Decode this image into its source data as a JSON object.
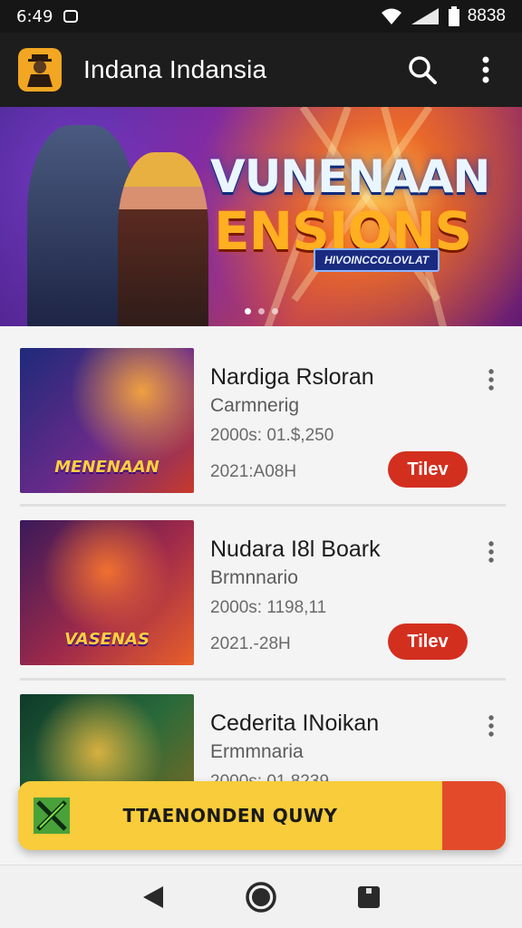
{
  "status_bar": {
    "time": "6:49",
    "battery": "8838"
  },
  "app": {
    "title": "Indana Indansia"
  },
  "banner": {
    "title": "VUNENAAN",
    "subtitle": "ENSIONS",
    "tag": "HIVOINCCOLOVLAT"
  },
  "games": [
    {
      "title": "Nardiga Rsloran",
      "genre": "Carmnerig",
      "downloads": "2000s: 01.$,250",
      "date": "2021:A08H",
      "action": "Tilev",
      "thumb_label": "MENENAAN",
      "thumb_colors": [
        "#1e2a7a",
        "#c83a2a"
      ]
    },
    {
      "title": "Nudara I8l Boark",
      "genre": "Brmnnario",
      "downloads": "2000s: 1198,11",
      "date": "2021.-28H",
      "action": "Tilev",
      "thumb_label": "VASENAS",
      "thumb_colors": [
        "#3a1a5a",
        "#e8602a"
      ]
    },
    {
      "title": "Cederita INoikan",
      "genre": "Ermmnaria",
      "downloads": "2000s: 01.8239",
      "date": "",
      "action": "",
      "thumb_label": "",
      "thumb_colors": [
        "#1a5a3a",
        "#c8a02a"
      ]
    }
  ],
  "promo": {
    "label": "TTAENONDEN QUWY"
  },
  "icons": {
    "search": "search-icon",
    "menu": "more-vert-icon",
    "back": "back-triangle-icon",
    "home": "home-circle-icon",
    "recents": "recents-square-icon"
  },
  "colors": {
    "accent_red": "#d32f1f",
    "promo_yellow": "#f8cc3a",
    "app_bar": "#1d1d1d"
  }
}
